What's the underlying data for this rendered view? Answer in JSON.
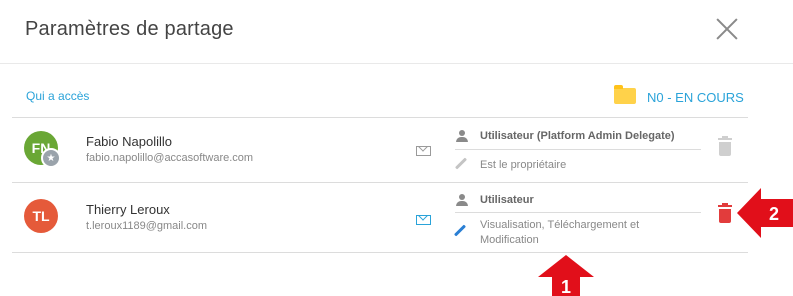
{
  "dialog": {
    "title": "Paramètres de partage"
  },
  "access_label": "Qui a accès",
  "folder": {
    "label": "N0 - EN COURS"
  },
  "users": [
    {
      "initials": "FN",
      "avatar_color": "#6aa735",
      "name": "Fabio Napolillo",
      "email": "fabio.napolillo@accasoftware.com",
      "role": "Utilisateur (Platform Admin Delegate)",
      "permission": "Est le propriétaire"
    },
    {
      "initials": "TL",
      "avatar_color": "#e55a3a",
      "name": "Thierry Leroux",
      "email": "t.leroux1189@gmail.com",
      "role": "Utilisateur",
      "permission": "Visualisation, Téléchargement et Modification"
    }
  ],
  "markers": {
    "one": "1",
    "two": "2"
  },
  "colors": {
    "accent": "#2aa3d9",
    "delete": "#e23c3c",
    "disabled": "#cfcfcf",
    "marker": "#e10f1a"
  },
  "icons": [
    "close-icon",
    "folder-icon",
    "mail-icon",
    "person-icon",
    "pencil-icon",
    "trash-icon",
    "star-icon"
  ]
}
